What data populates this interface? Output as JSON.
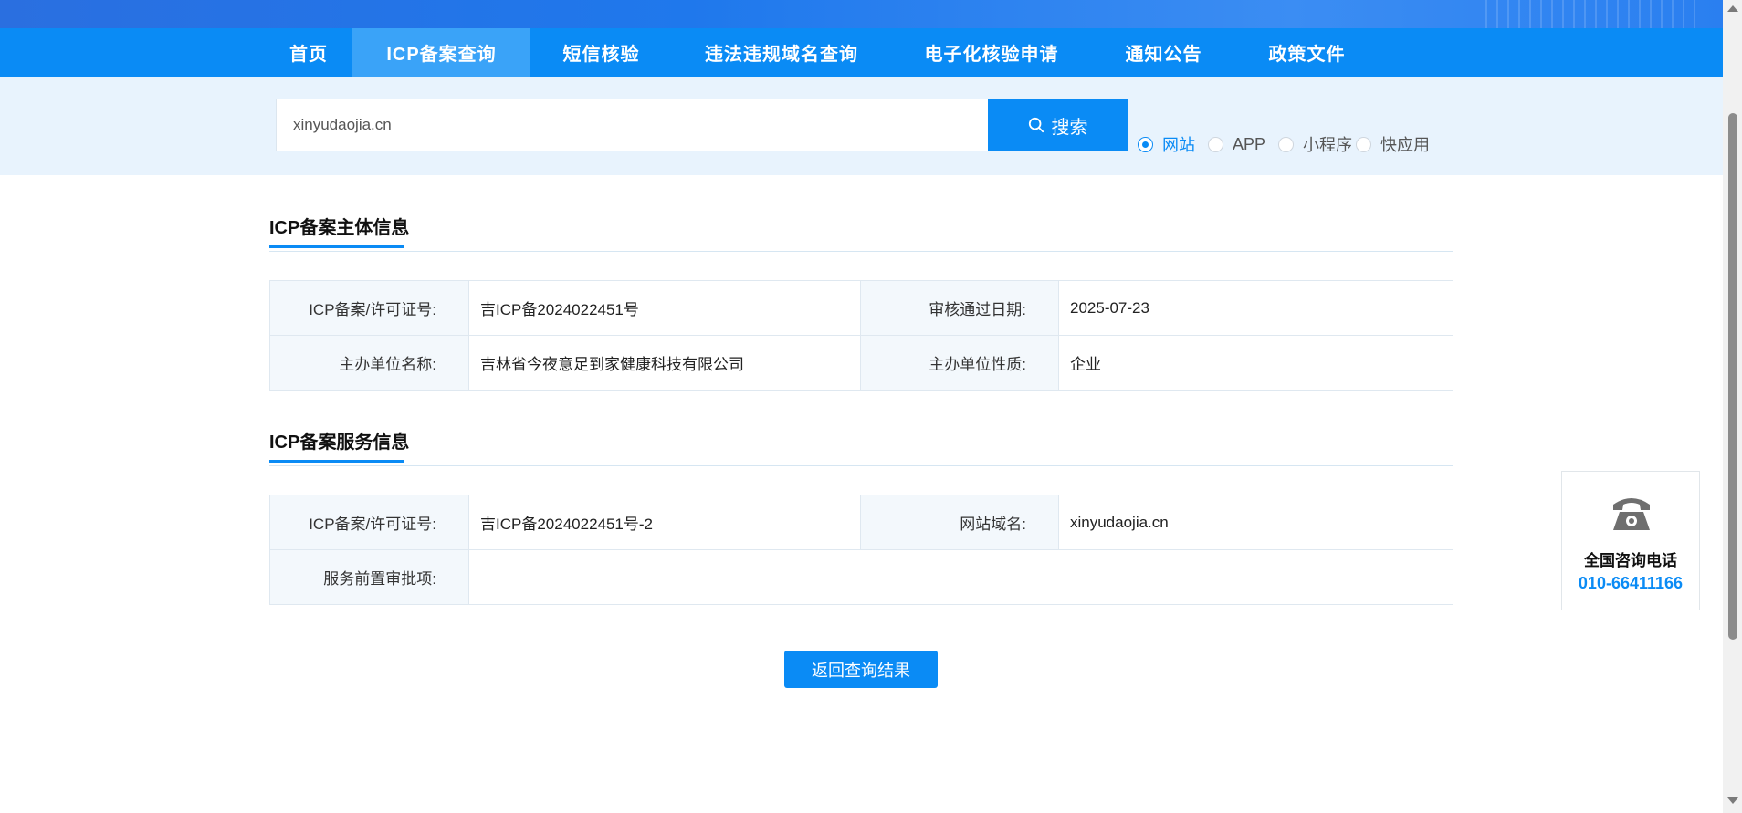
{
  "nav": {
    "items": [
      {
        "label": "首页"
      },
      {
        "label": "ICP备案查询",
        "active": true
      },
      {
        "label": "短信核验"
      },
      {
        "label": "违法违规域名查询"
      },
      {
        "label": "电子化核验申请"
      },
      {
        "label": "通知公告"
      },
      {
        "label": "政策文件"
      }
    ]
  },
  "search": {
    "value": "xinyudaojia.cn",
    "button_label": "搜索",
    "types": [
      {
        "label": "网站",
        "checked": true
      },
      {
        "label": "APP"
      },
      {
        "label": "小程序"
      },
      {
        "label": "快应用"
      }
    ]
  },
  "subject_section": {
    "title": "ICP备案主体信息",
    "rows": [
      {
        "l1": "ICP备案/许可证号:",
        "v1": "吉ICP备2024022451号",
        "l2": "审核通过日期:",
        "v2": "2025-07-23"
      },
      {
        "l1": "主办单位名称:",
        "v1": "吉林省今夜意足到家健康科技有限公司",
        "l2": "主办单位性质:",
        "v2": "企业"
      }
    ]
  },
  "service_section": {
    "title": "ICP备案服务信息",
    "row1": {
      "l1": "ICP备案/许可证号:",
      "v1": "吉ICP备2024022451号-2",
      "l2": "网站域名:",
      "v2": "xinyudaojia.cn"
    },
    "row2": {
      "l1": "服务前置审批项:",
      "v1": ""
    }
  },
  "back_button": "返回查询结果",
  "hotline": {
    "icon": "phone-icon",
    "label": "全国咨询电话",
    "number": "010-66411166"
  },
  "colors": {
    "primary": "#0a8bf5",
    "nav_active": "#3aa3f8",
    "search_band": "#e8f3fd"
  }
}
